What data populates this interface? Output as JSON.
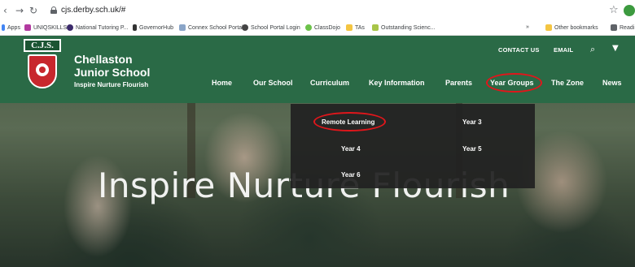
{
  "browser": {
    "url": "cjs.derby.sch.uk/#",
    "back_icon": "back-arrow",
    "forward_icon": "forward-arrow",
    "reload_icon": "reload",
    "bookmarks": [
      {
        "label": "Apps",
        "icon_color": "#4285f4"
      },
      {
        "label": "UNIQSKILLS",
        "icon_color": "#b23aa0"
      },
      {
        "label": "National Tutoring P...",
        "icon_color": "#3b2a6b"
      },
      {
        "label": "GovernorHub",
        "icon_color": "#333333"
      },
      {
        "label": "Connex School Portal",
        "icon_color": "#8aa5c8"
      },
      {
        "label": "School Portal Login",
        "icon_color": "#444444"
      },
      {
        "label": "ClassDojo",
        "icon_color": "#6cc24a"
      },
      {
        "label": "TAs",
        "icon_color": "#f4c542"
      },
      {
        "label": "Outstanding Scienc...",
        "icon_color": "#a8c548"
      },
      {
        "label": "»",
        "icon_color": ""
      },
      {
        "label": "Other bookmarks",
        "icon_color": "#f4c542"
      },
      {
        "label": "Readi",
        "icon_color": "#5f6368"
      }
    ]
  },
  "site": {
    "crest_text": "C.J.S.",
    "name_line1": "Chellaston",
    "name_line2": "Junior School",
    "tagline": "Inspire Nurture Flourish",
    "util": {
      "contact": "CONTACT US",
      "email": "EMAIL",
      "search_icon": "⌕",
      "twitter_icon": "🐦"
    },
    "nav": [
      "Home",
      "Our School",
      "Curriculum",
      "Key Information",
      "Parents",
      "Year Groups",
      "The Zone",
      "News"
    ],
    "dropdown": {
      "remote": "Remote Learning",
      "year3": "Year 3",
      "year4": "Year 4",
      "year5": "Year 5",
      "year6": "Year 6"
    },
    "motto": "Inspire  Nurture  Flourish",
    "colors": {
      "header_green": "#2a6a46",
      "highlight_ring": "#e0161b",
      "dropdown_bg": "#212121"
    }
  }
}
